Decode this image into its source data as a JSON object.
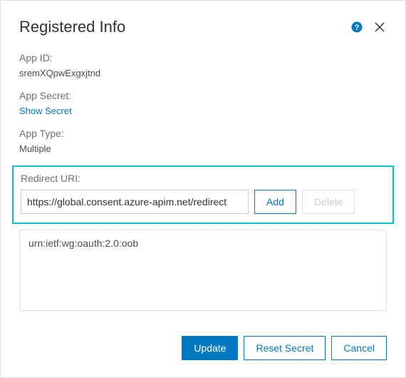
{
  "header": {
    "title": "Registered Info"
  },
  "fields": {
    "appId": {
      "label": "App ID:",
      "value": "sremXQpwExgxjtnd"
    },
    "appSecret": {
      "label": "App Secret:",
      "showLink": "Show Secret"
    },
    "appType": {
      "label": "App Type:",
      "value": "Multiple"
    },
    "redirectUri": {
      "label": "Redirect URI:",
      "inputValue": "https://global.consent.azure-apim.net/redirect",
      "addLabel": "Add",
      "deleteLabel": "Delete",
      "listItem": "urn:ietf:wg:oauth:2.0:oob"
    }
  },
  "footer": {
    "update": "Update",
    "resetSecret": "Reset Secret",
    "cancel": "Cancel"
  }
}
